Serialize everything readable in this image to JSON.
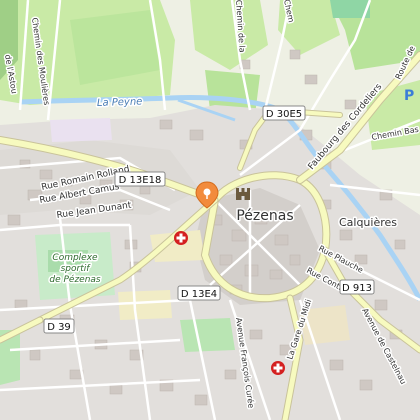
{
  "map": {
    "town_label": "Pézenas",
    "place_labels": {
      "calquieres": "Calquières"
    },
    "river_label": "La Peyne",
    "sports_label_line1": "Complexe",
    "sports_label_line2": "sportif",
    "sports_label_line3": "de Pézenas",
    "streets": {
      "romain_rolland": "Rue Romain Rolland",
      "albert_camus": "Rue Albert Camus",
      "jean_dunant": "Rue Jean Dunant",
      "chemin_moulieres": "Chemin des Moulières",
      "chemin_astou": "de l'Astou",
      "chemin_chem": "Chem",
      "chemin_de_la": "Chemin de la",
      "chemin_bas": "Chemin Bas",
      "faubourg_cordeliers": "Faubourg des Cordeliers",
      "route_de": "Route de",
      "rue_plauche": "Rue Plauche",
      "rue_conti": "Rue Conti",
      "avenue_francois_curee": "Avenue François Curée",
      "avenue_castelnau": "Avenue de Castelnau",
      "la_gare_du_midi": "La Gare du Midi"
    },
    "road_shields": {
      "d13e18": "D 13E18",
      "d30e5": "D 30E5",
      "d13e4": "D 13E4",
      "d913": "D 913",
      "d39": "D 39"
    },
    "parking_symbol": "P",
    "colors": {
      "background": "#f2efe9",
      "urban": "#e0dfdf",
      "farmland": "#c8eaa4",
      "vineyard": "#addf9a",
      "park": "#cdeccb",
      "water": "#a9d3f4",
      "major_road": "#f7fabf",
      "road_casing": "#c9c39a",
      "marker": "#f28b3c",
      "pharmacy": "#d42020",
      "parking": "#3b7dd8"
    },
    "icons": {
      "location_marker": "map-pin-icon",
      "pharmacy": "pharmacy-cross-icon",
      "monument": "castle-icon",
      "parking": "parking-icon"
    }
  }
}
